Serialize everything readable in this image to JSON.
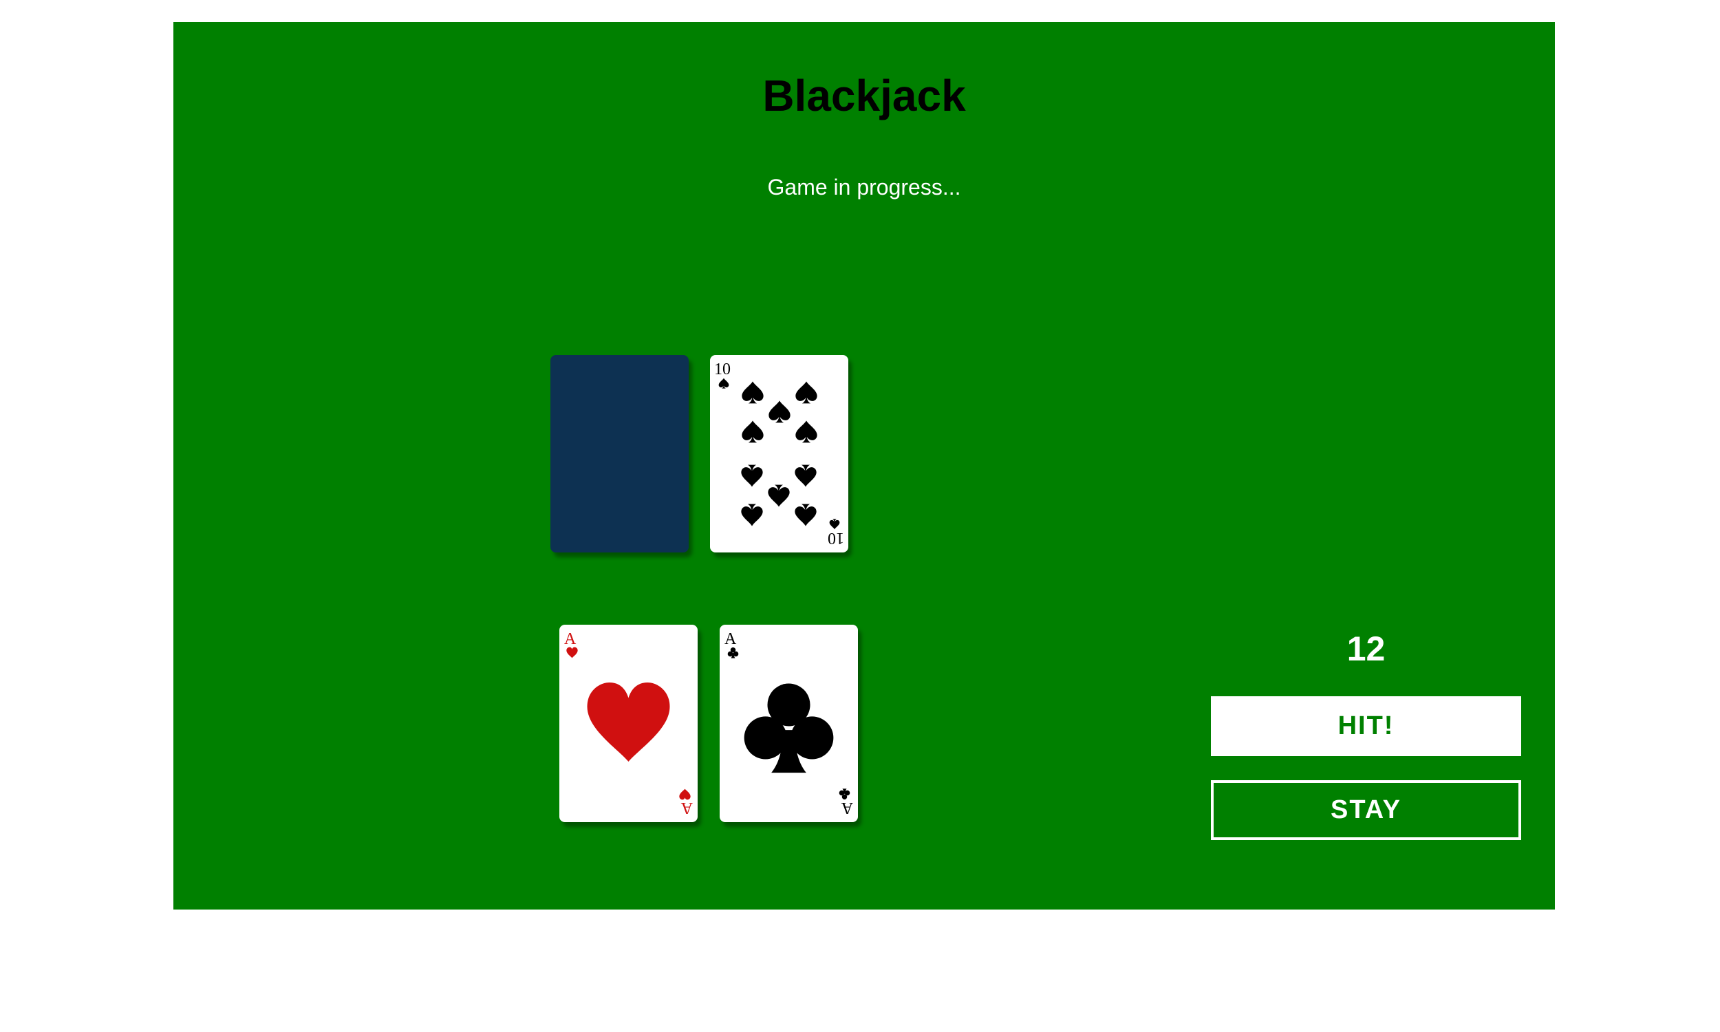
{
  "game": {
    "title": "Blackjack",
    "status": "Game in progress..."
  },
  "dealer": {
    "cards": [
      {
        "face_down": true,
        "back_color": "#0d3152"
      },
      {
        "rank": "10",
        "suit": "spades",
        "color": "#000000"
      }
    ]
  },
  "player": {
    "cards": [
      {
        "rank": "A",
        "suit": "hearts",
        "color": "#d01010"
      },
      {
        "rank": "A",
        "suit": "clubs",
        "color": "#000000"
      }
    ],
    "total": "12"
  },
  "controls": {
    "hit_label": "HIT!",
    "stay_label": "STAY"
  },
  "theme": {
    "table_color": "#008000",
    "page_background": "#ffffff"
  }
}
